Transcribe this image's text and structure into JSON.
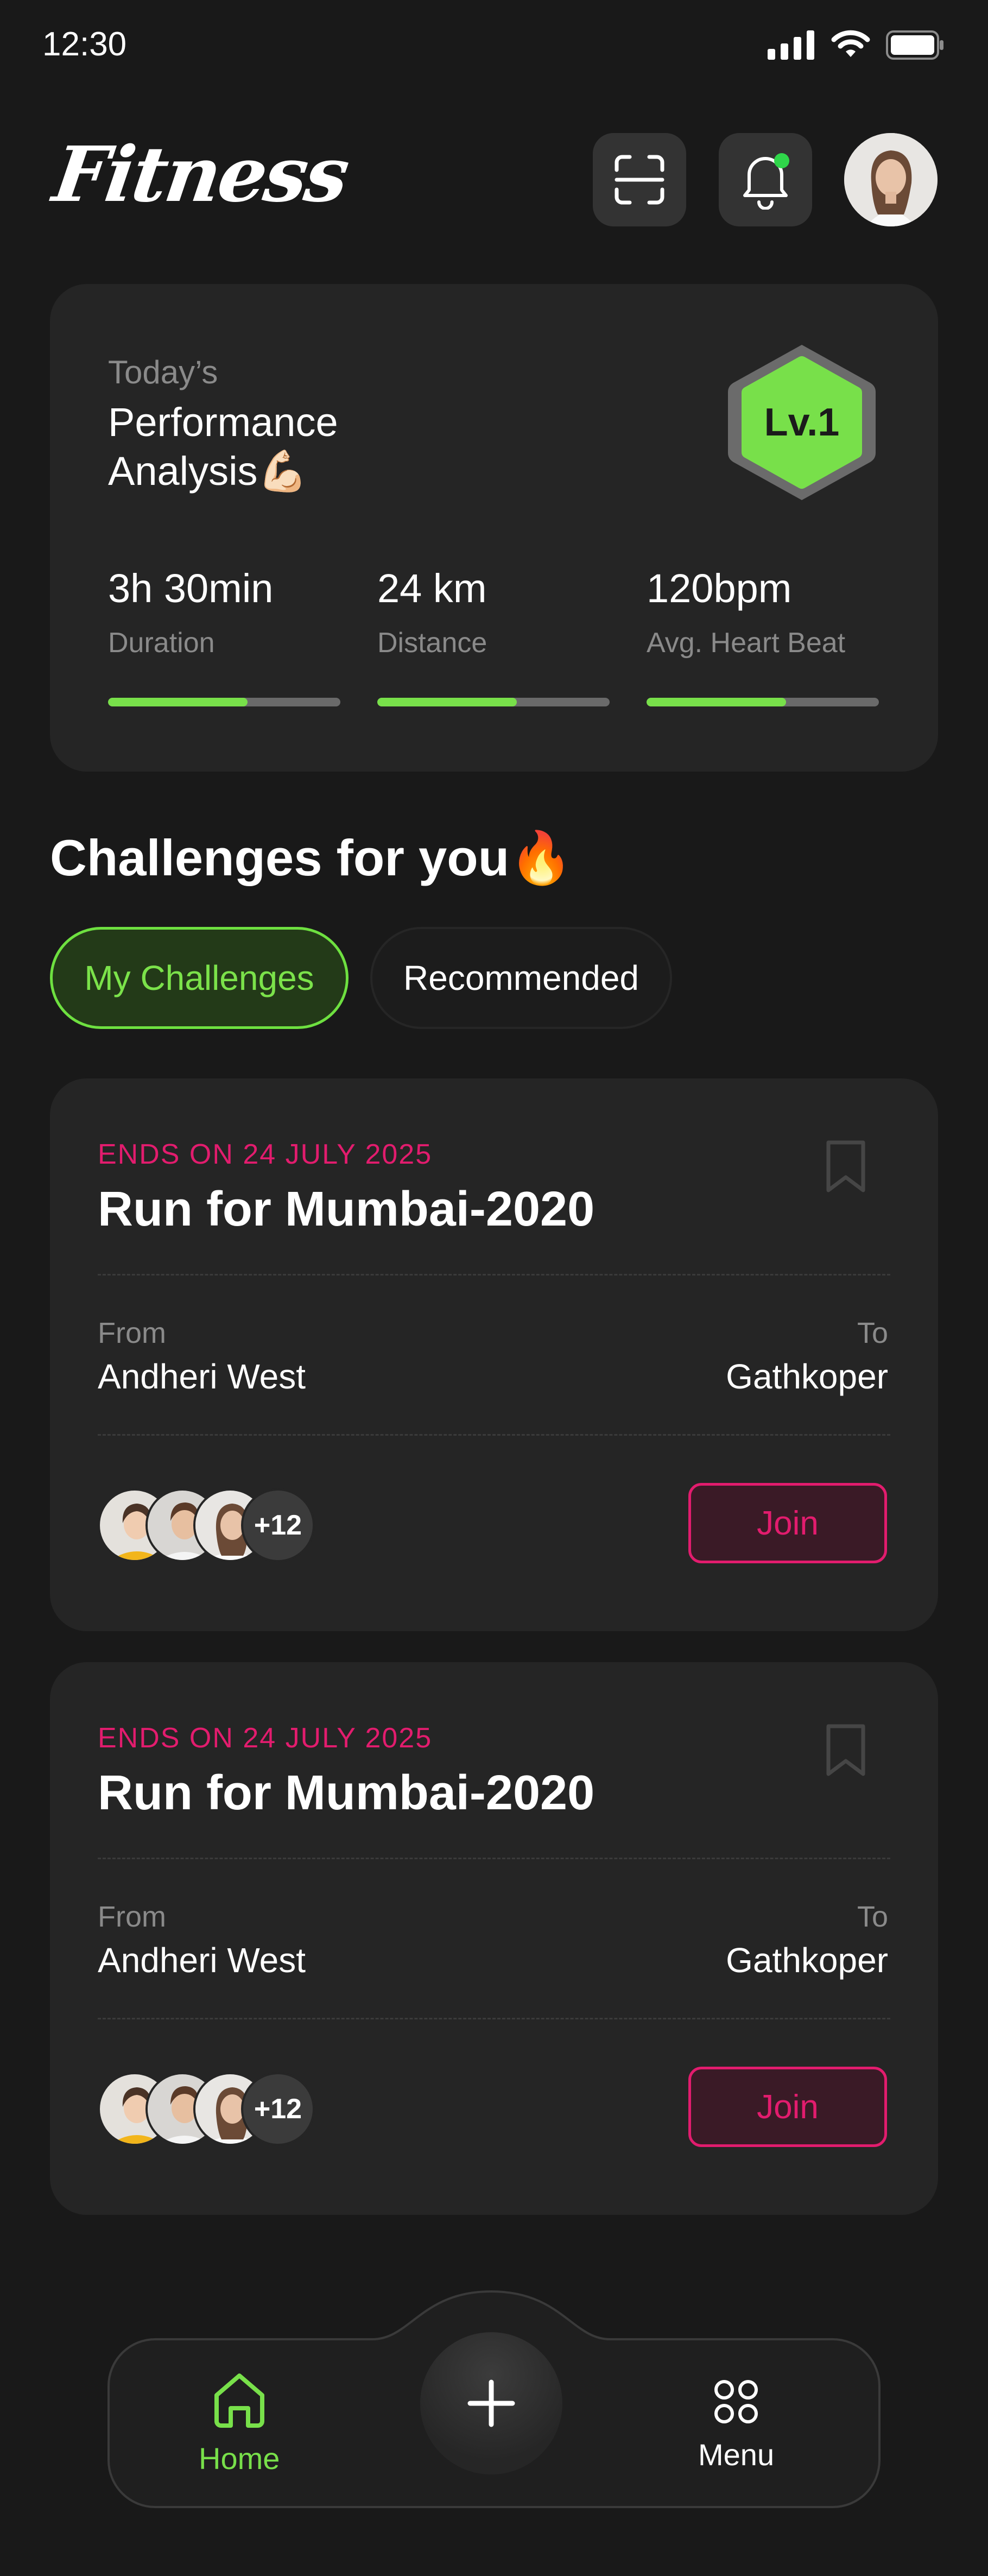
{
  "status_bar": {
    "time": "12:30"
  },
  "header": {
    "app_name": "Fitness"
  },
  "performance": {
    "subtitle": "Today’s",
    "title": "Performance Analysis💪🏻",
    "level": "Lv.1",
    "stats": [
      {
        "value": "3h 30min",
        "label": "Duration",
        "progress": 0.6
      },
      {
        "value": "24 km",
        "label": "Distance",
        "progress": 0.6
      },
      {
        "value": "120bpm",
        "label": "Avg. Heart Beat",
        "progress": 0.6
      }
    ]
  },
  "challenges": {
    "section_title": "Challenges for you🔥",
    "tabs": [
      {
        "label": "My Challenges",
        "active": true
      },
      {
        "label": "Recommended",
        "active": false
      }
    ],
    "cards": [
      {
        "ends": "ENDS ON 24 JULY 2025",
        "title": "Run for Mumbai-2020",
        "from_label": "From",
        "from": "Andheri West",
        "to_label": "To",
        "to": "Gathkoper",
        "participants_more": "+12",
        "join_label": "Join"
      },
      {
        "ends": "ENDS ON 24 JULY 2025",
        "title": "Run for Mumbai-2020",
        "from_label": "From",
        "from": "Andheri West",
        "to_label": "To",
        "to": "Gathkoper",
        "participants_more": "+12",
        "join_label": "Join"
      }
    ]
  },
  "bottom_nav": {
    "home_label": "Home",
    "menu_label": "Menu"
  },
  "colors": {
    "accent_green": "#78e04a",
    "accent_pink": "#e21c6e",
    "background": "#191919",
    "card": "#252525"
  }
}
